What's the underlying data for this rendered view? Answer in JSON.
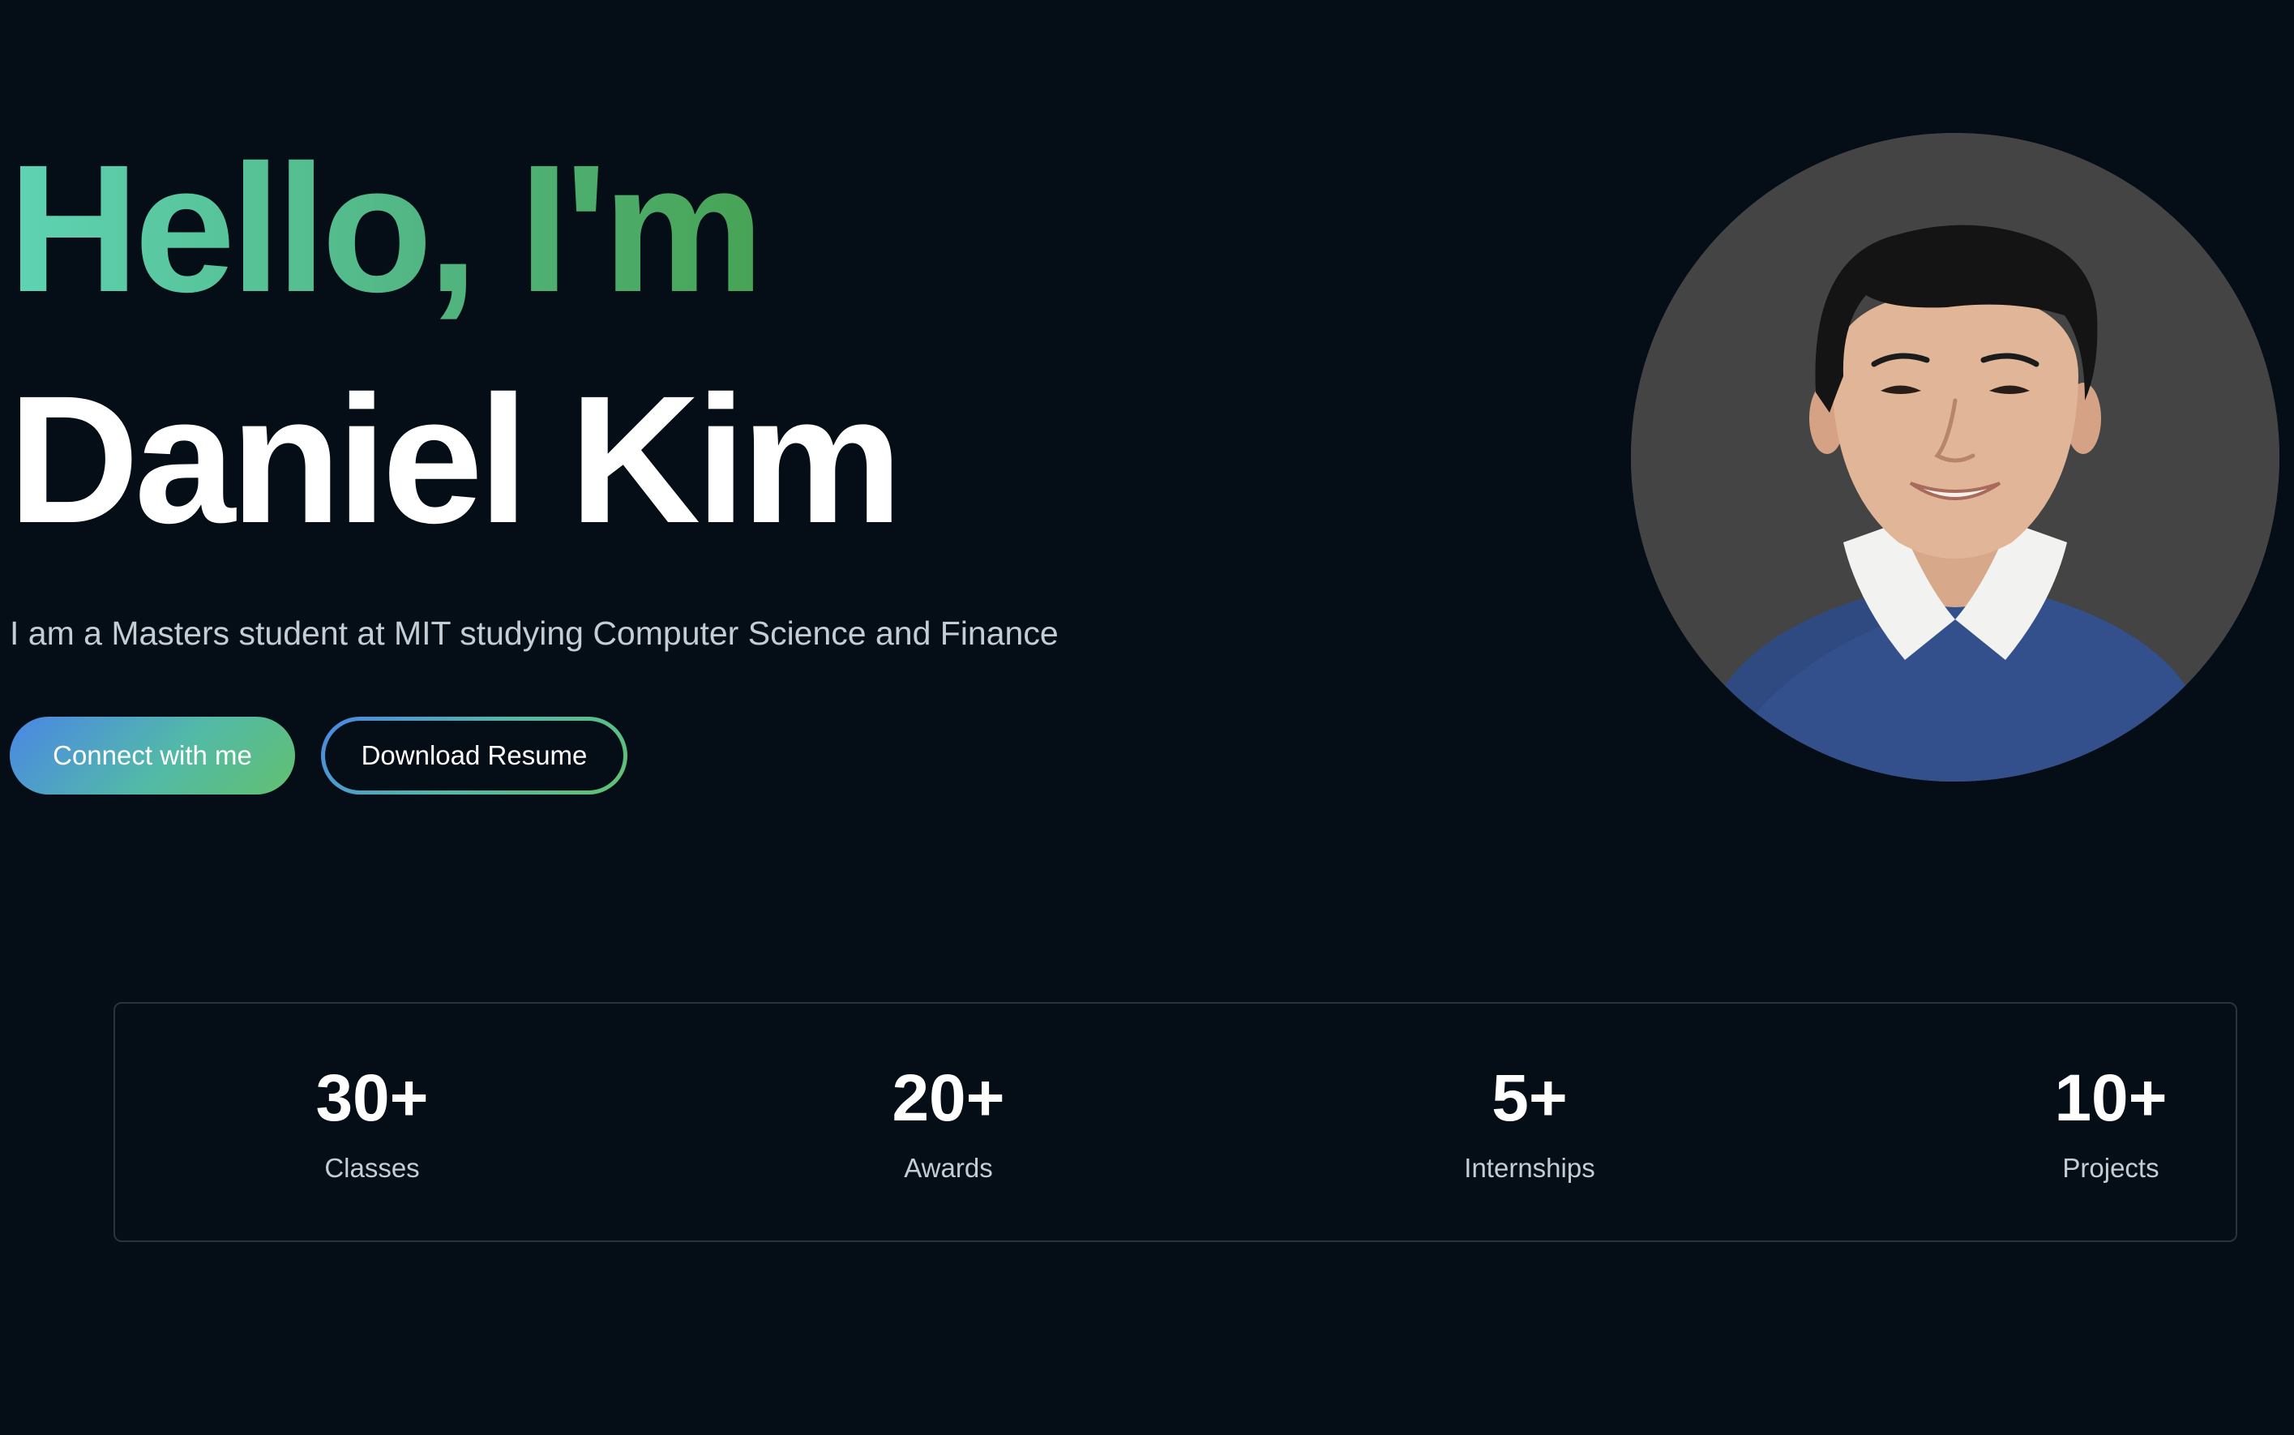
{
  "hero": {
    "greeting": "Hello, I'm",
    "name": "Daniel Kim",
    "subtitle": "I am a Masters student at MIT studying Computer Science and Finance",
    "primary_button": "Connect with me",
    "secondary_button": "Download Resume"
  },
  "colors": {
    "background": "#050d16",
    "greeting_gradient_start": "#5ed3b3",
    "greeting_gradient_end": "#47a354",
    "button_gradient_start": "#4a86e6",
    "button_gradient_end": "#62c070",
    "avatar_backdrop": "#444444",
    "sweater": "#33508c"
  },
  "stats": [
    {
      "value": "30+",
      "label": "Classes"
    },
    {
      "value": "20+",
      "label": "Awards"
    },
    {
      "value": "5+",
      "label": "Internships"
    },
    {
      "value": "10+",
      "label": "Projects"
    }
  ]
}
